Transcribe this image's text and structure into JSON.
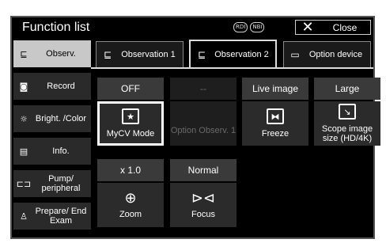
{
  "header": {
    "title": "Function list",
    "badge_rdi": "RDI",
    "badge_nbi": "NBI",
    "close_label": "Close"
  },
  "sidebar": {
    "items": [
      {
        "label": "Observ.",
        "icon": "observation-icon",
        "active": true
      },
      {
        "label": "Record",
        "icon": "record-icon"
      },
      {
        "label": "Bright. /Color",
        "icon": "brightness-icon"
      },
      {
        "label": "Info.",
        "icon": "info-icon"
      },
      {
        "label": "Pump/ peripheral",
        "icon": "pump-icon"
      },
      {
        "label": "Prepare/ End Exam",
        "icon": "prepare-icon"
      }
    ]
  },
  "tabs": [
    {
      "label": "Observation 1",
      "icon": "observation-icon"
    },
    {
      "label": "Observation 2",
      "icon": "observation-icon",
      "active": true
    },
    {
      "label": "Option device",
      "icon": "option-device-icon"
    }
  ],
  "grid": {
    "row1": {
      "values": [
        "OFF",
        "--",
        "Live image",
        "Large"
      ],
      "actions": [
        "MyCV Mode",
        "Option Observ. 1",
        "Freeze",
        "Scope image size (HD/4K)"
      ]
    },
    "row2": {
      "values": [
        "x 1.0",
        "Normal"
      ],
      "actions": [
        "Zoom",
        "Focus"
      ]
    }
  },
  "colors": {
    "background": "#000000",
    "active_sidebar": "#c8c8c8",
    "cell": "#2b2b2b",
    "disabled_text": "#6a6a6a"
  }
}
